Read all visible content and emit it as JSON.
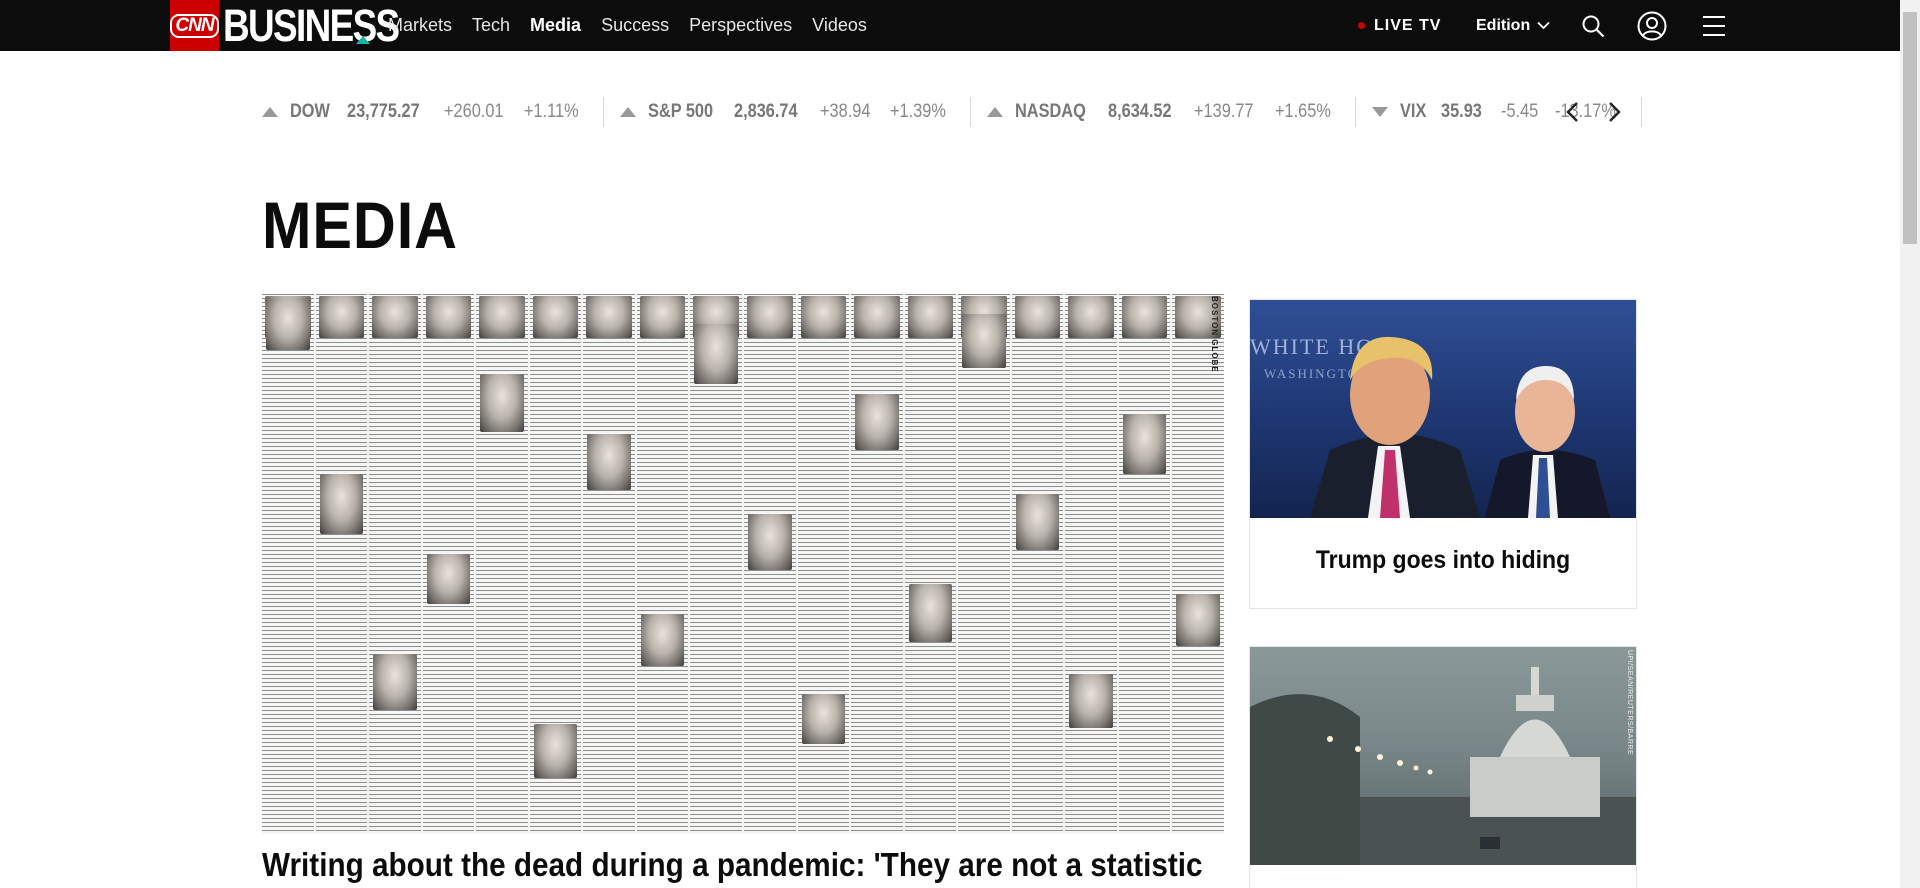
{
  "brand": {
    "cnn": "CNN",
    "section": "BUSINESS"
  },
  "nav": {
    "links": [
      {
        "label": "Markets",
        "active": false
      },
      {
        "label": "Tech",
        "active": false
      },
      {
        "label": "Media",
        "active": true
      },
      {
        "label": "Success",
        "active": false
      },
      {
        "label": "Perspectives",
        "active": false
      },
      {
        "label": "Videos",
        "active": false
      }
    ],
    "live_tv": "LIVE TV",
    "edition": "Edition",
    "icons": [
      "search-icon",
      "account-icon",
      "hamburger-menu-icon"
    ]
  },
  "ticker": [
    {
      "symbol": "DOW",
      "price": "23,775.27",
      "change": "+260.01",
      "percent": "+1.11%",
      "direction": "up"
    },
    {
      "symbol": "S&P 500",
      "price": "2,836.74",
      "change": "+38.94",
      "percent": "+1.39%",
      "direction": "up"
    },
    {
      "symbol": "NASDAQ",
      "price": "8,634.52",
      "change": "+139.77",
      "percent": "+1.65%",
      "direction": "up"
    },
    {
      "symbol": "VIX",
      "price": "35.93",
      "change": "-5.45",
      "percent": "-13.17%",
      "direction": "down"
    }
  ],
  "page_title": "MEDIA",
  "hero": {
    "headline": "Writing about the dead during a pandemic: 'They are not a statistic",
    "image_label": "BOSTON GLOBE"
  },
  "cards": [
    {
      "title": "Trump goes into hiding",
      "image_text": "WHITE HO",
      "image_subtext": "WASHINGTON"
    },
    {
      "title": "",
      "credit": "UPI/SEAN/REUTERS/BARRE"
    }
  ],
  "colors": {
    "brand_red": "#cc0000",
    "nav_bg": "#0c0c0c",
    "accent_teal": "#17b6a7"
  }
}
